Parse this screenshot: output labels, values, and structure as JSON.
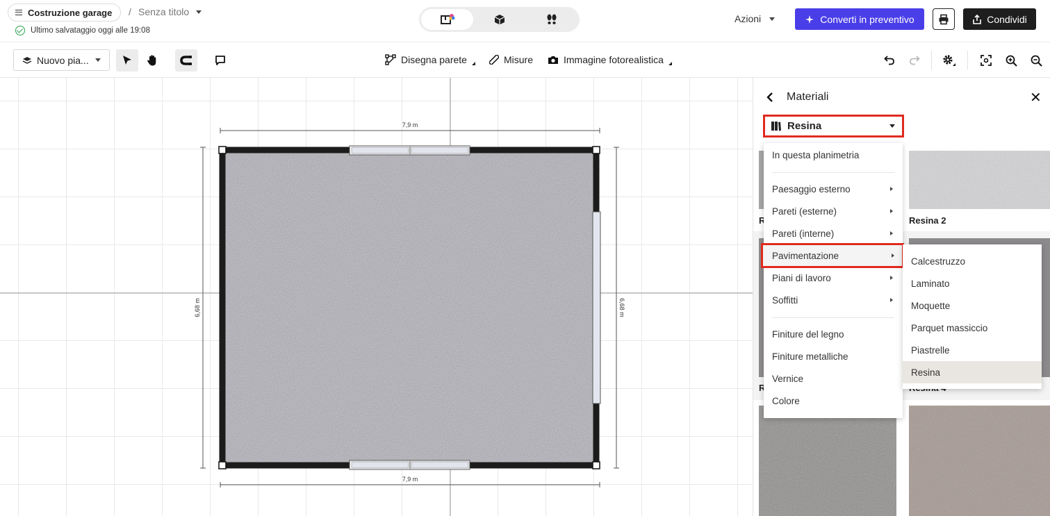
{
  "header": {
    "project_name": "Costruzione garage",
    "separator": "/",
    "doc_title": "Senza titolo",
    "save_status": "Ultimo salvataggio oggi alle 19:08",
    "actions_label": "Azioni",
    "convert_label": "Converti in preventivo",
    "share_label": "Condividi"
  },
  "toolbar": {
    "floor_label": "Nuovo pia...",
    "draw_wall_label": "Disegna parete",
    "measures_label": "Misure",
    "render_label": "Immagine fotorealistica"
  },
  "plan": {
    "width_label": "7,9 m",
    "height_label": "6,68 m"
  },
  "panel": {
    "title": "Materiali",
    "selected_category": "Resina",
    "tiles": [
      {
        "label": "R"
      },
      {
        "label": "Resina 2"
      },
      {
        "label": "R"
      },
      {
        "label": "Resina 4"
      }
    ]
  },
  "menu": {
    "items": [
      {
        "label": "In questa planimetria",
        "has_sub": false
      },
      {
        "label": "Paesaggio esterno",
        "has_sub": true
      },
      {
        "label": "Pareti (esterne)",
        "has_sub": true
      },
      {
        "label": "Pareti (interne)",
        "has_sub": true
      },
      {
        "label": "Pavimentazione",
        "has_sub": true
      },
      {
        "label": "Piani di lavoro",
        "has_sub": true
      },
      {
        "label": "Soffitti",
        "has_sub": true
      },
      {
        "label": "Finiture del legno",
        "has_sub": false
      },
      {
        "label": "Finiture metalliche",
        "has_sub": false
      },
      {
        "label": "Vernice",
        "has_sub": false
      },
      {
        "label": "Colore",
        "has_sub": false
      }
    ]
  },
  "submenu": {
    "items": [
      "Calcestruzzo",
      "Laminato",
      "Moquette",
      "Parquet massiccio",
      "Piastrelle",
      "Resina"
    ],
    "selected": "Resina"
  },
  "colors": {
    "accent": "#4a3ee8",
    "highlight": "#e02a1f",
    "floor": "#9d9ca2",
    "wall": "#1c1c1c"
  }
}
